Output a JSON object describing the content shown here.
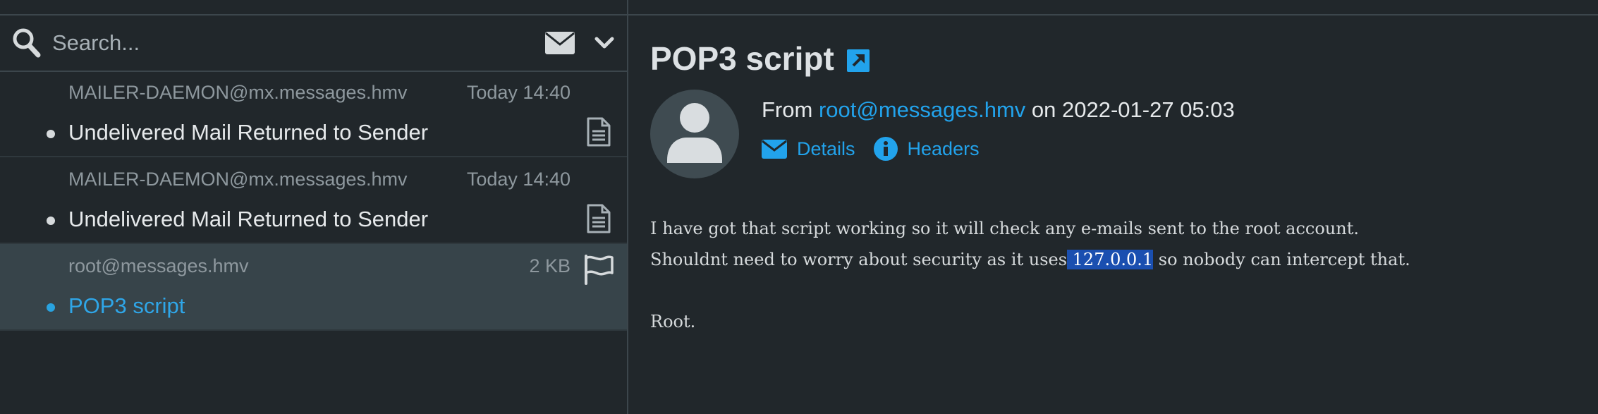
{
  "search": {
    "placeholder": "Search..."
  },
  "toolbar": {
    "envelope_icon": "envelope-icon",
    "chevron_icon": "chevron-down-icon"
  },
  "messages": [
    {
      "sender": "MAILER-DAEMON@mx.messages.hmv",
      "meta": "Today 14:40",
      "subject": "Undelivered Mail Returned to Sender",
      "icon": "document-icon",
      "selected": false
    },
    {
      "sender": "MAILER-DAEMON@mx.messages.hmv",
      "meta": "Today 14:40",
      "subject": "Undelivered Mail Returned to Sender",
      "icon": "document-icon",
      "selected": false
    },
    {
      "sender": "root@messages.hmv",
      "meta": "2 KB",
      "subject": "POP3 script",
      "icon": "flag-icon",
      "selected": true
    }
  ],
  "reader": {
    "title": "POP3 script",
    "from_prefix": "From ",
    "from_address": "root@messages.hmv",
    "date_text": " on 2022-01-27 05:03",
    "actions": {
      "details": "Details",
      "headers": "Headers"
    },
    "body": {
      "line1": "I have got that script working so it will check any e-mails sent to the root account.",
      "line2_before": "Shouldnt need to worry about security as it uses",
      "line2_highlight": " 127.0.0.1",
      "line2_after": " so nobody can intercept that.",
      "signature": "Root."
    }
  },
  "colors": {
    "background": "#21272b",
    "accent": "#22a3ec",
    "selected_row": "#37444a",
    "highlight": "#1a4fb0"
  }
}
